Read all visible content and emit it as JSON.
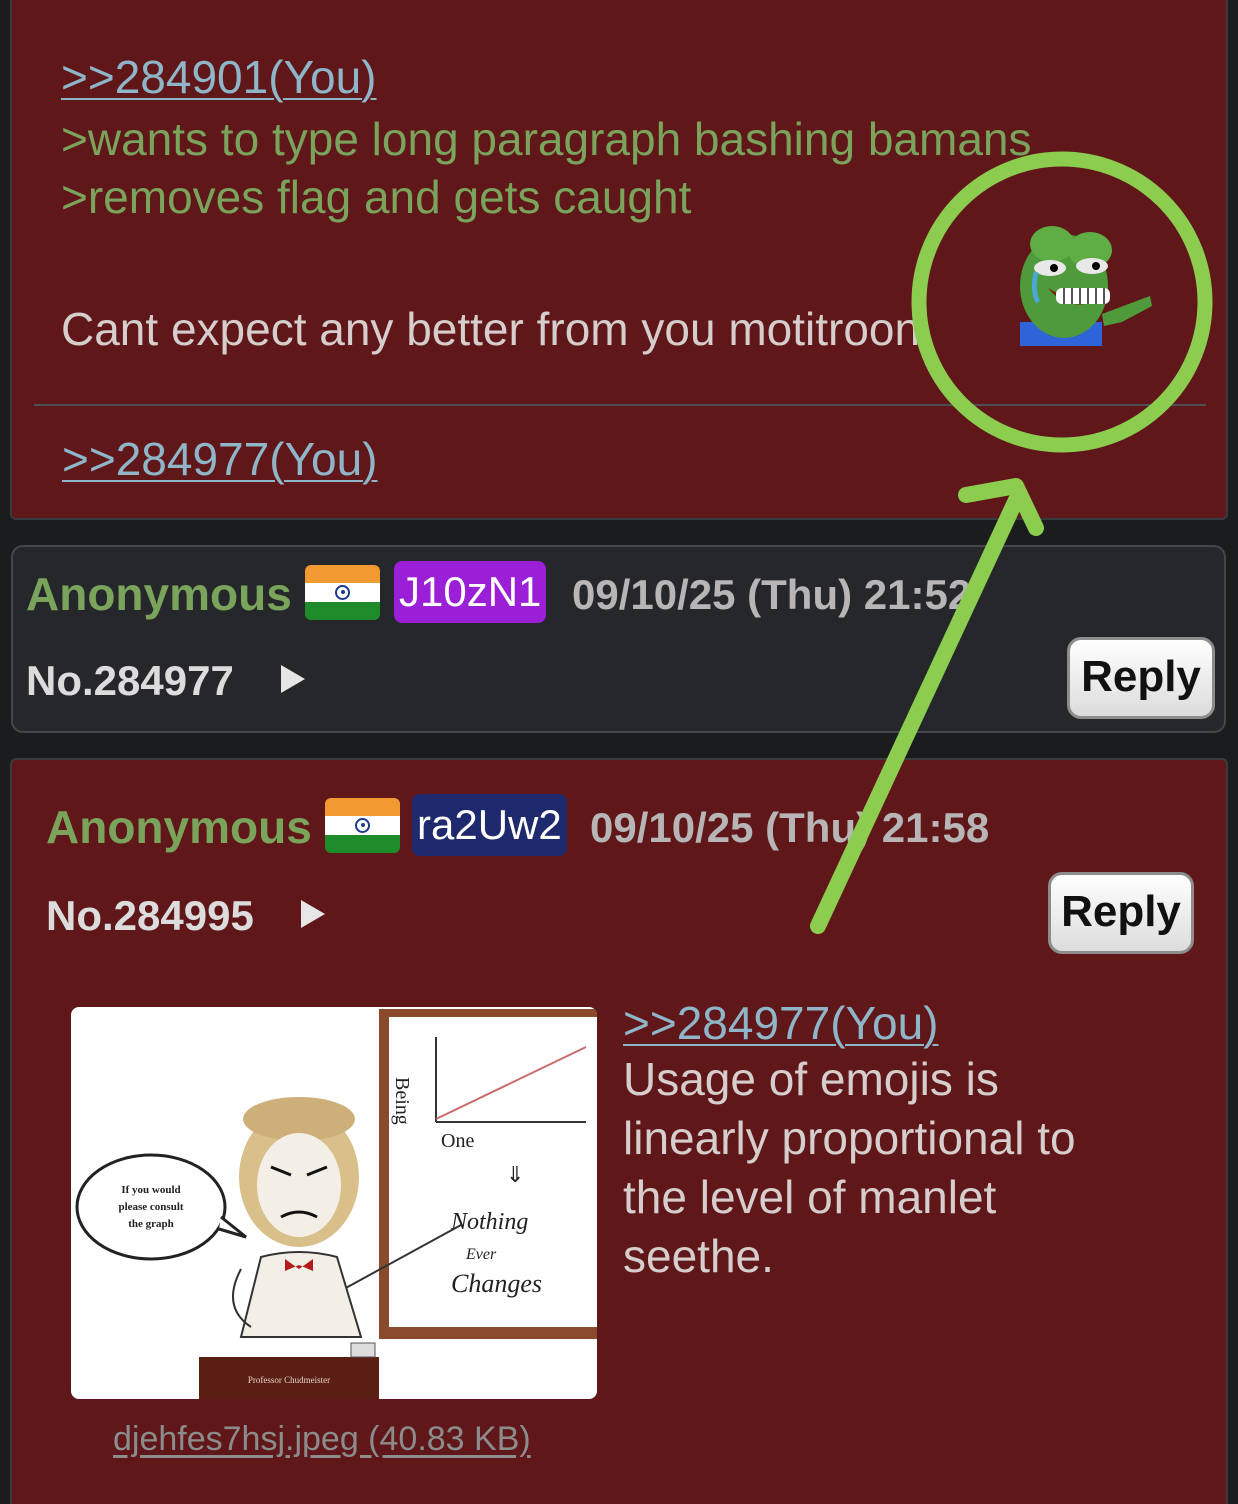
{
  "post_top": {
    "quote": ">>284901(You)",
    "greentext": [
      ">wants to type long paragraph bashing bamans",
      ">removes flag and gets caught"
    ],
    "body": "Cant expect any better from you motitroon",
    "emoji": "pepe-pointing-emoji",
    "backlink": ">>284977(You)"
  },
  "post_284977": {
    "name": "Anonymous",
    "flag": "india-flag",
    "poster_id": "J10zN1",
    "poster_id_color": "#9b1fd6",
    "datetime": "09/10/25 (Thu) 21:52",
    "number": "No.284977",
    "reply_label": "Reply"
  },
  "post_284995": {
    "name": "Anonymous",
    "flag": "india-flag",
    "poster_id": "ra2Uw2",
    "poster_id_color": "#1f2a6e",
    "datetime": "09/10/25 (Thu) 21:58",
    "number": "No.284995",
    "reply_label": "Reply",
    "quote": ">>284977(You)",
    "body": [
      "Usage of emojis is",
      "linearly proportional to",
      "the level of manlet",
      "seethe."
    ],
    "image": {
      "filename": "djehfes7hsj.jpeg (40.83 KB)",
      "speech": [
        "If you would",
        "please consult",
        "the graph"
      ],
      "graph_ylabel": "Being",
      "graph_xlabel": "One",
      "board_text": [
        "Nothing",
        "Ever",
        "Changes"
      ],
      "podium": "Professor Chudmeister"
    }
  },
  "annotation": {
    "color": "#8ccd4f"
  }
}
